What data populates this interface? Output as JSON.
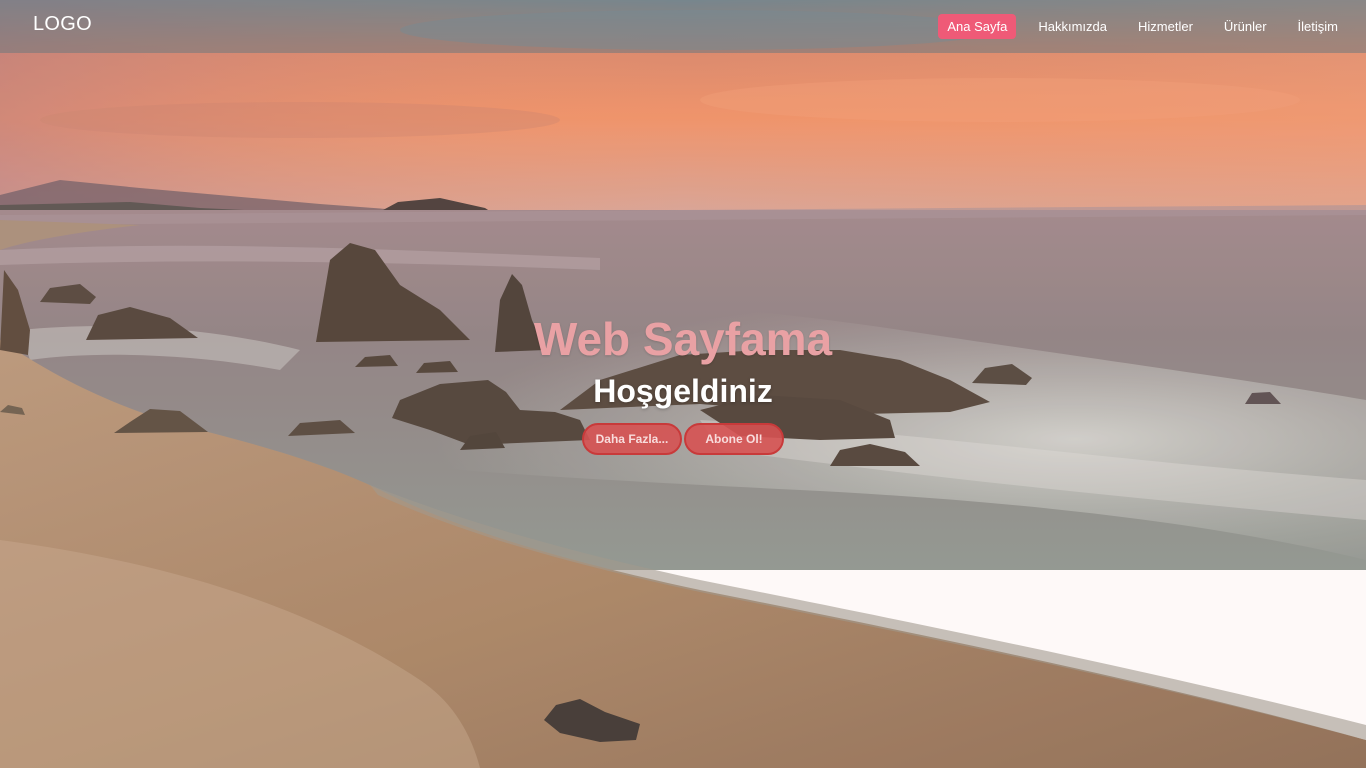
{
  "navbar": {
    "logo": "LOGO",
    "items": [
      {
        "label": "Ana Sayfa",
        "active": true
      },
      {
        "label": "Hakkımızda",
        "active": false
      },
      {
        "label": "Hizmetler",
        "active": false
      },
      {
        "label": "Ürünler",
        "active": false
      },
      {
        "label": "İletişim",
        "active": false
      }
    ]
  },
  "hero": {
    "title": "Web Sayfama",
    "subtitle": "Hoşgeldiniz",
    "buttons": {
      "more": "Daha Fazla...",
      "subscribe": "Abone Ol!"
    }
  },
  "colors": {
    "nav_active": "#ef5a77",
    "title": "#e9a1a4",
    "button_bg": "#d65252",
    "button_border": "#c83a3a"
  }
}
